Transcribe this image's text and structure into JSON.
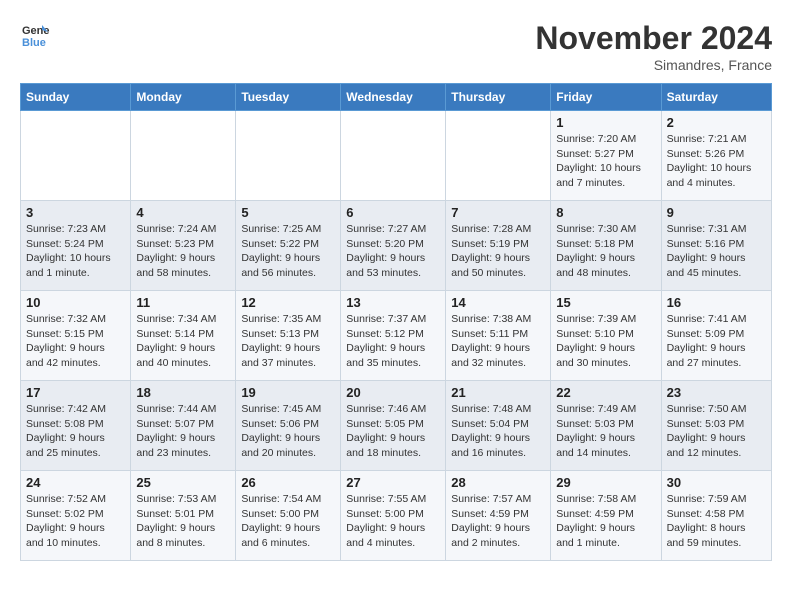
{
  "header": {
    "logo_line1": "General",
    "logo_line2": "Blue",
    "month": "November 2024",
    "location": "Simandres, France"
  },
  "weekdays": [
    "Sunday",
    "Monday",
    "Tuesday",
    "Wednesday",
    "Thursday",
    "Friday",
    "Saturday"
  ],
  "weeks": [
    [
      {
        "day": "",
        "info": ""
      },
      {
        "day": "",
        "info": ""
      },
      {
        "day": "",
        "info": ""
      },
      {
        "day": "",
        "info": ""
      },
      {
        "day": "",
        "info": ""
      },
      {
        "day": "1",
        "info": "Sunrise: 7:20 AM\nSunset: 5:27 PM\nDaylight: 10 hours\nand 7 minutes."
      },
      {
        "day": "2",
        "info": "Sunrise: 7:21 AM\nSunset: 5:26 PM\nDaylight: 10 hours\nand 4 minutes."
      }
    ],
    [
      {
        "day": "3",
        "info": "Sunrise: 7:23 AM\nSunset: 5:24 PM\nDaylight: 10 hours\nand 1 minute."
      },
      {
        "day": "4",
        "info": "Sunrise: 7:24 AM\nSunset: 5:23 PM\nDaylight: 9 hours\nand 58 minutes."
      },
      {
        "day": "5",
        "info": "Sunrise: 7:25 AM\nSunset: 5:22 PM\nDaylight: 9 hours\nand 56 minutes."
      },
      {
        "day": "6",
        "info": "Sunrise: 7:27 AM\nSunset: 5:20 PM\nDaylight: 9 hours\nand 53 minutes."
      },
      {
        "day": "7",
        "info": "Sunrise: 7:28 AM\nSunset: 5:19 PM\nDaylight: 9 hours\nand 50 minutes."
      },
      {
        "day": "8",
        "info": "Sunrise: 7:30 AM\nSunset: 5:18 PM\nDaylight: 9 hours\nand 48 minutes."
      },
      {
        "day": "9",
        "info": "Sunrise: 7:31 AM\nSunset: 5:16 PM\nDaylight: 9 hours\nand 45 minutes."
      }
    ],
    [
      {
        "day": "10",
        "info": "Sunrise: 7:32 AM\nSunset: 5:15 PM\nDaylight: 9 hours\nand 42 minutes."
      },
      {
        "day": "11",
        "info": "Sunrise: 7:34 AM\nSunset: 5:14 PM\nDaylight: 9 hours\nand 40 minutes."
      },
      {
        "day": "12",
        "info": "Sunrise: 7:35 AM\nSunset: 5:13 PM\nDaylight: 9 hours\nand 37 minutes."
      },
      {
        "day": "13",
        "info": "Sunrise: 7:37 AM\nSunset: 5:12 PM\nDaylight: 9 hours\nand 35 minutes."
      },
      {
        "day": "14",
        "info": "Sunrise: 7:38 AM\nSunset: 5:11 PM\nDaylight: 9 hours\nand 32 minutes."
      },
      {
        "day": "15",
        "info": "Sunrise: 7:39 AM\nSunset: 5:10 PM\nDaylight: 9 hours\nand 30 minutes."
      },
      {
        "day": "16",
        "info": "Sunrise: 7:41 AM\nSunset: 5:09 PM\nDaylight: 9 hours\nand 27 minutes."
      }
    ],
    [
      {
        "day": "17",
        "info": "Sunrise: 7:42 AM\nSunset: 5:08 PM\nDaylight: 9 hours\nand 25 minutes."
      },
      {
        "day": "18",
        "info": "Sunrise: 7:44 AM\nSunset: 5:07 PM\nDaylight: 9 hours\nand 23 minutes."
      },
      {
        "day": "19",
        "info": "Sunrise: 7:45 AM\nSunset: 5:06 PM\nDaylight: 9 hours\nand 20 minutes."
      },
      {
        "day": "20",
        "info": "Sunrise: 7:46 AM\nSunset: 5:05 PM\nDaylight: 9 hours\nand 18 minutes."
      },
      {
        "day": "21",
        "info": "Sunrise: 7:48 AM\nSunset: 5:04 PM\nDaylight: 9 hours\nand 16 minutes."
      },
      {
        "day": "22",
        "info": "Sunrise: 7:49 AM\nSunset: 5:03 PM\nDaylight: 9 hours\nand 14 minutes."
      },
      {
        "day": "23",
        "info": "Sunrise: 7:50 AM\nSunset: 5:03 PM\nDaylight: 9 hours\nand 12 minutes."
      }
    ],
    [
      {
        "day": "24",
        "info": "Sunrise: 7:52 AM\nSunset: 5:02 PM\nDaylight: 9 hours\nand 10 minutes."
      },
      {
        "day": "25",
        "info": "Sunrise: 7:53 AM\nSunset: 5:01 PM\nDaylight: 9 hours\nand 8 minutes."
      },
      {
        "day": "26",
        "info": "Sunrise: 7:54 AM\nSunset: 5:00 PM\nDaylight: 9 hours\nand 6 minutes."
      },
      {
        "day": "27",
        "info": "Sunrise: 7:55 AM\nSunset: 5:00 PM\nDaylight: 9 hours\nand 4 minutes."
      },
      {
        "day": "28",
        "info": "Sunrise: 7:57 AM\nSunset: 4:59 PM\nDaylight: 9 hours\nand 2 minutes."
      },
      {
        "day": "29",
        "info": "Sunrise: 7:58 AM\nSunset: 4:59 PM\nDaylight: 9 hours\nand 1 minute."
      },
      {
        "day": "30",
        "info": "Sunrise: 7:59 AM\nSunset: 4:58 PM\nDaylight: 8 hours\nand 59 minutes."
      }
    ]
  ]
}
